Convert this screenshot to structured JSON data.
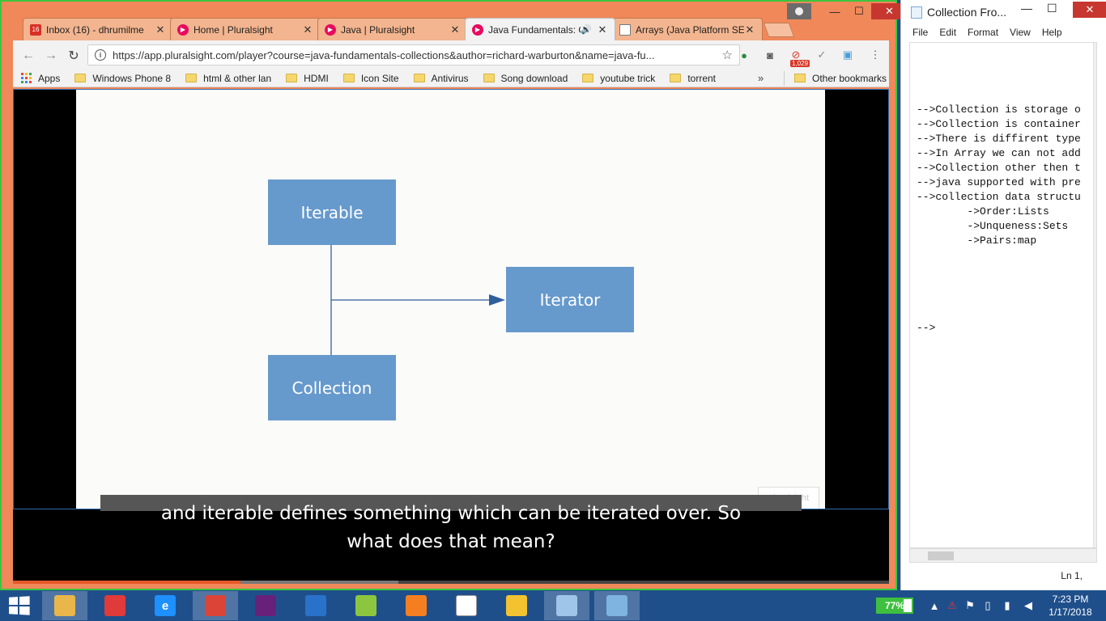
{
  "browser": {
    "tabs": [
      {
        "title": "Inbox (16) - dhrumilme",
        "icon": "gmail-icon",
        "color": "#d93025",
        "badge": "16",
        "active": false
      },
      {
        "title": "Home | Pluralsight",
        "icon": "pluralsight-icon",
        "color": "#e80a5e",
        "active": false
      },
      {
        "title": "Java | Pluralsight",
        "icon": "pluralsight-icon",
        "color": "#e80a5e",
        "active": false
      },
      {
        "title": "Java Fundamentals: C",
        "icon": "pluralsight-icon",
        "color": "#e80a5e",
        "active": true
      },
      {
        "title": "Arrays (Java Platform SE",
        "icon": "document-icon",
        "color": "#ffffff",
        "active": false
      }
    ],
    "url": "https://app.pluralsight.com/player?course=java-fundamentals-collections&author=richard-warburton&name=java-fu...",
    "extension_badge": "1,029",
    "bookmarks": [
      "Apps",
      "Windows Phone 8",
      "html & other lan",
      "HDMI",
      "Icon Site",
      "Antivirus",
      "Song download",
      "youtube trick",
      "torrent"
    ],
    "bookmarks_more": "»",
    "other_bookmarks": "Other bookmarks"
  },
  "player": {
    "diagram": {
      "nodes": {
        "iterable": "Iterable",
        "iterator": "Iterator",
        "collection": "Collection"
      }
    },
    "watermark": "pluralsight",
    "caption_line1": "and iterable defines something which can be iterated over. So",
    "caption_line2": "what does that mean?",
    "progress_played": 0.26,
    "progress_buffered": 0.44
  },
  "notepad": {
    "title": "Collection Fro...",
    "menu": [
      "File",
      "Edit",
      "Format",
      "View",
      "Help"
    ],
    "lines": [
      "-->Collection is storage o",
      "-->Collection is container",
      "-->There is diffirent type",
      "-->In Array we can not add",
      "-->Collection other then t",
      "-->java supported with pre",
      "-->collection data structu",
      "        ->Order:Lists",
      "        ->Unqueness:Sets",
      "        ->Pairs:map",
      "",
      "",
      "",
      "",
      "",
      "-->"
    ],
    "status": "Ln 1, "
  },
  "taskbar": {
    "apps": [
      {
        "name": "file-explorer-icon",
        "label": "",
        "color": "#e8b64b",
        "active": true
      },
      {
        "name": "store-grid-icon",
        "label": "",
        "color": "#e03a3a",
        "active": false
      },
      {
        "name": "internet-explorer-icon",
        "label": "e",
        "color": "#1e90ff",
        "active": false
      },
      {
        "name": "chrome-icon",
        "label": "",
        "color": "#db4437",
        "active": true
      },
      {
        "name": "visual-studio-purple-icon",
        "label": "",
        "color": "#68217a",
        "active": false
      },
      {
        "name": "visual-studio-blue-icon",
        "label": "",
        "color": "#2a72c9",
        "active": false
      },
      {
        "name": "notepad-plus-icon",
        "label": "",
        "color": "#8cc63f",
        "active": false
      },
      {
        "name": "xampp-icon",
        "label": "",
        "color": "#f57f20",
        "active": false
      },
      {
        "name": "blank-document-icon",
        "label": "",
        "color": "#ffffff",
        "active": false
      },
      {
        "name": "database-tools-icon",
        "label": "",
        "color": "#f2c230",
        "active": false
      },
      {
        "name": "notepad-icon",
        "label": "",
        "color": "#9fc5e8",
        "active": true
      },
      {
        "name": "photo-viewer-icon",
        "label": "",
        "color": "#7fb3e0",
        "active": true
      }
    ],
    "battery": "77%",
    "battery_level": 0.77,
    "time": "7:23 PM",
    "date": "1/17/2018"
  }
}
